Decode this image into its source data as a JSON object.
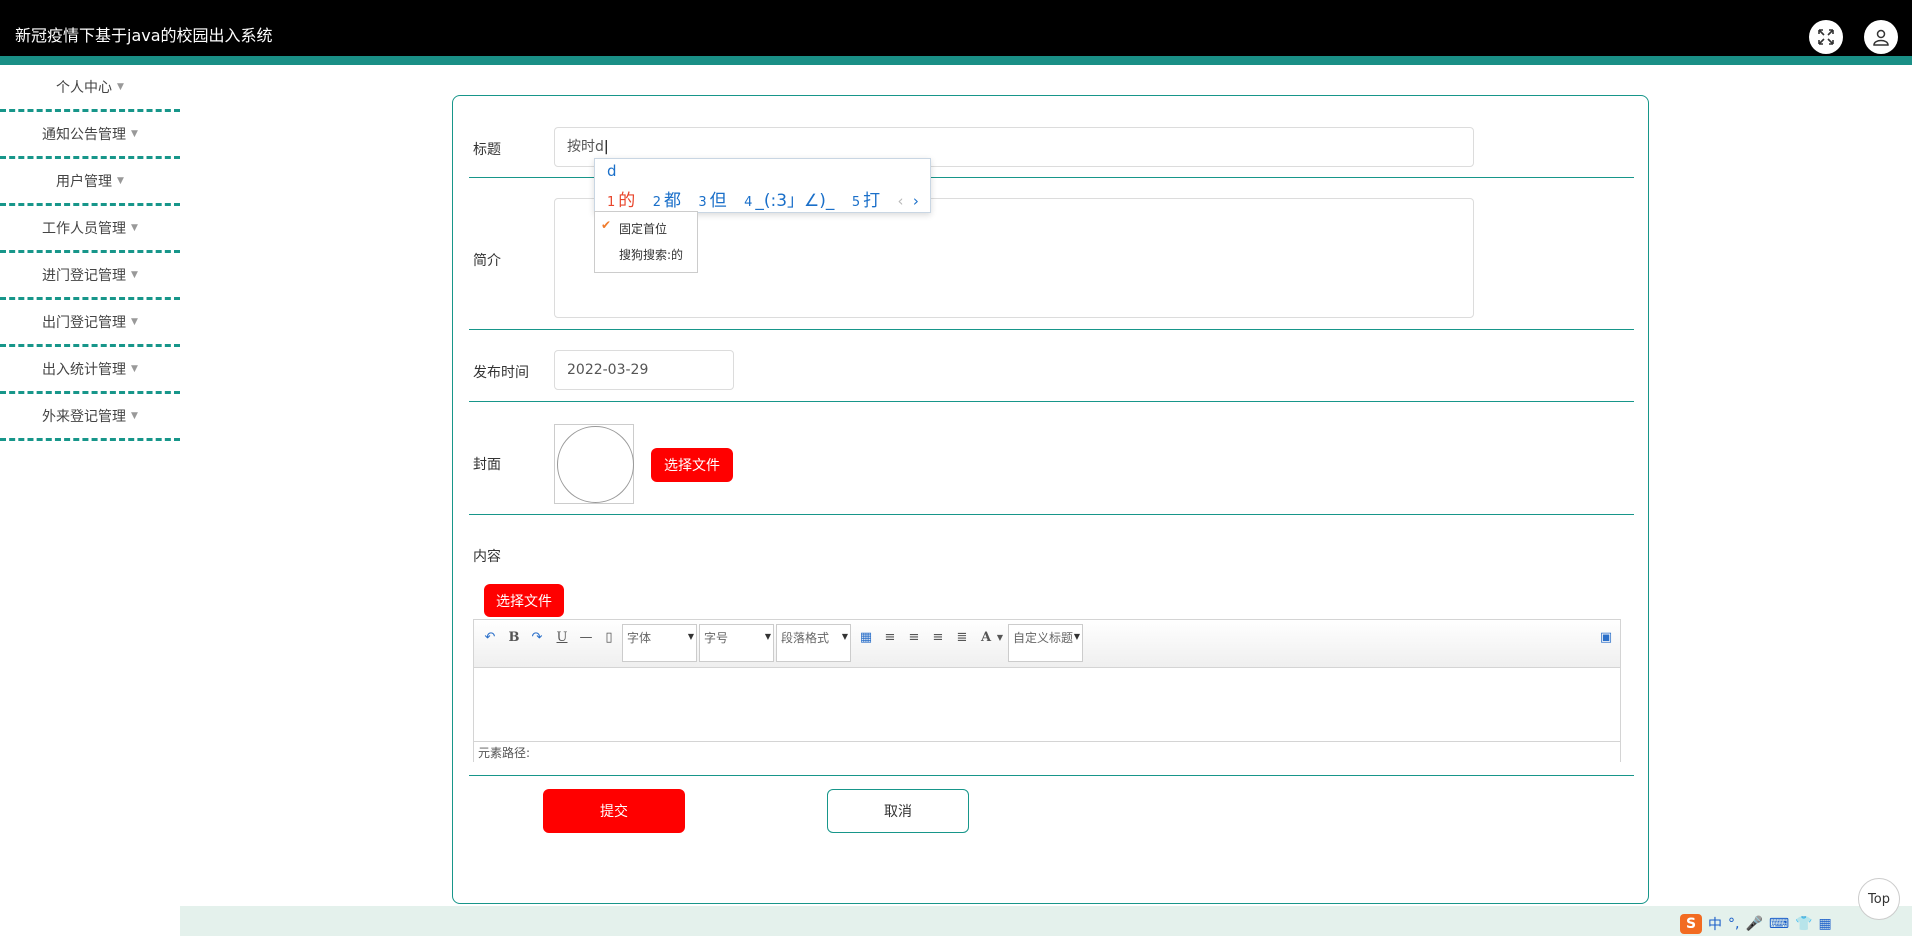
{
  "app": {
    "title": "新冠疫情下基于java的校园出入系统"
  },
  "sidebar": {
    "items": [
      {
        "label": "个人中心"
      },
      {
        "label": "通知公告管理"
      },
      {
        "label": "用户管理"
      },
      {
        "label": "工作人员管理"
      },
      {
        "label": "进门登记管理"
      },
      {
        "label": "出门登记管理"
      },
      {
        "label": "出入统计管理"
      },
      {
        "label": "外来登记管理"
      }
    ]
  },
  "form": {
    "title_label": "标题",
    "title_value": "按时d",
    "intro_label": "简介",
    "publish_label": "发布时间",
    "publish_value": "2022-03-29",
    "cover_label": "封面",
    "choose_file": "选择文件",
    "content_label": "内容",
    "content_choose_file": "选择文件",
    "submit": "提交",
    "cancel": "取消"
  },
  "editor": {
    "font_combo": "字体",
    "size_combo": "字号",
    "para_combo": "段落格式",
    "custom_title_combo": "自定义标题",
    "status_path": "元素路径:"
  },
  "ime": {
    "typed": "d",
    "candidates": [
      {
        "n": "1",
        "text": "的"
      },
      {
        "n": "2",
        "text": "都"
      },
      {
        "n": "3",
        "text": "但"
      },
      {
        "n": "4",
        "text": "_(:3」∠)_"
      },
      {
        "n": "5",
        "text": "打"
      }
    ],
    "menu_fix": "固定首位",
    "menu_search": "搜狗搜索:的"
  },
  "top_button": "Top",
  "tray": {
    "lang": "中"
  },
  "colors": {
    "accent": "#17968a",
    "danger": "#ff0000",
    "header": "#000000"
  }
}
